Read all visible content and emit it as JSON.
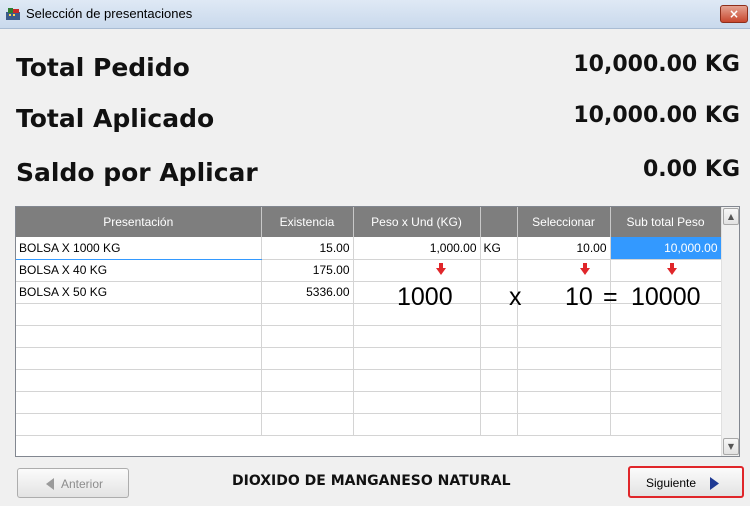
{
  "window": {
    "title": "Selección de presentaciones",
    "close_label": "×"
  },
  "summary": {
    "total_pedido_label": "Total Pedido",
    "total_pedido_value": "10,000.00 KG",
    "total_aplicado_label": "Total Aplicado",
    "total_aplicado_value": "10,000.00 KG",
    "saldo_label": "Saldo por Aplicar",
    "saldo_value": "0.00 KG"
  },
  "grid": {
    "columns": [
      "Presentación",
      "Existencia",
      "Peso x Und (KG)",
      "",
      "Seleccionar",
      "Sub total Peso"
    ],
    "rows": [
      {
        "presentacion": "BOLSA X 1000 KG",
        "existencia": "15.00",
        "peso": "1,000.00",
        "unidad": "KG",
        "seleccionar": "10.00",
        "subtotal": "10,000.00"
      },
      {
        "presentacion": "BOLSA X 40 KG",
        "existencia": "175.00",
        "peso": "",
        "unidad": "",
        "seleccionar": "",
        "subtotal": ""
      },
      {
        "presentacion": "BOLSA X 50 KG",
        "existencia": "5336.00",
        "peso": "",
        "unidad": "",
        "seleccionar": "",
        "subtotal": ""
      }
    ]
  },
  "annotation": {
    "a": "1000",
    "op": "x",
    "b": "10",
    "eq": "=",
    "result": "10000",
    "arrow_color": "#e0262a"
  },
  "footer": {
    "prev_label": "Anterior",
    "product_name": "DIOXIDO DE MANGANESO NATURAL",
    "next_label": "Siguiente"
  },
  "icons": {
    "app": "cash-register-icon",
    "prev": "triangle-left-icon",
    "next": "triangle-right-icon"
  }
}
